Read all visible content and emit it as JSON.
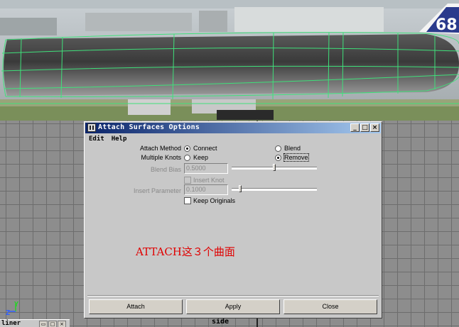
{
  "dialog": {
    "title": "Attach Surfaces Options",
    "title_buttons": [
      "_",
      "□",
      "×"
    ],
    "menu": [
      "Edit",
      "Help"
    ],
    "attach_method": {
      "label": "Attach Method",
      "options": [
        "Connect",
        "Blend"
      ],
      "selected": "Connect"
    },
    "multiple_knots": {
      "label": "Multiple Knots",
      "options": [
        "Keep",
        "Remove"
      ],
      "selected": "Remove"
    },
    "blend_bias": {
      "label": "Blend Bias",
      "value": "0.5000",
      "level": 0.5
    },
    "insert_knot": {
      "label": "Insert Knot",
      "checked": false,
      "disabled": true
    },
    "insert_parameter": {
      "label": "Insert Parameter",
      "value": "0.1000",
      "level": 0.1
    },
    "keep_originals": {
      "label": "Keep Originals",
      "checked": false
    },
    "annotation": "ATTACH这３个曲面",
    "buttons": {
      "attach": "Attach",
      "apply": "Apply",
      "close": "Close"
    }
  },
  "viewport": {
    "panel_label": "side",
    "axis_y": "Y",
    "axis_z": "Z",
    "mini_panel_label": "liner"
  },
  "colors": {
    "curve": "#3fe07a",
    "annotation": "#e00000",
    "titlebar_start": "#0a246a",
    "titlebar_end": "#a6caf0"
  }
}
